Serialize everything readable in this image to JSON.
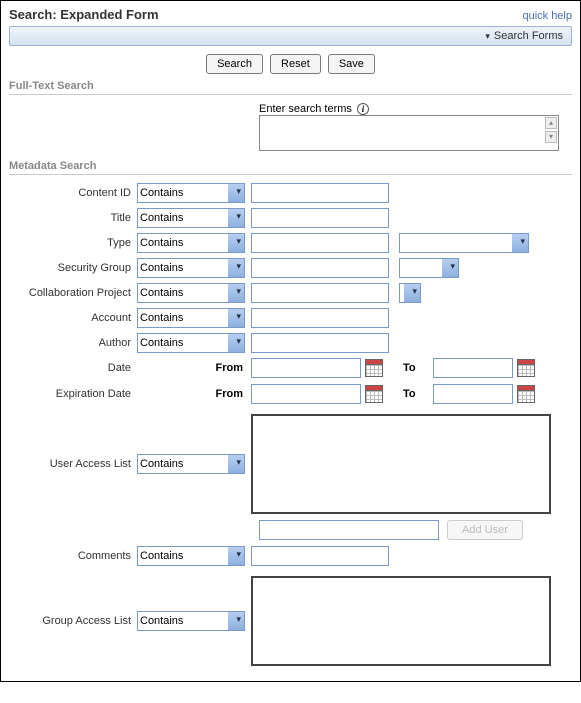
{
  "header": {
    "title": "Search: Expanded Form",
    "quick_help": "quick help",
    "search_forms_label": "Search Forms"
  },
  "buttons": {
    "search": "Search",
    "reset": "Reset",
    "save": "Save"
  },
  "sections": {
    "fulltext_title": "Full-Text Search",
    "fulltext_label": "Enter search terms",
    "metadata_title": "Metadata Search"
  },
  "operators": {
    "contains": "Contains"
  },
  "fields": {
    "content_id": "Content ID",
    "title": "Title",
    "type": "Type",
    "security_group": "Security Group",
    "collab_project": "Collaboration Project",
    "account": "Account",
    "author": "Author",
    "date": "Date",
    "expiration_date": "Expiration Date",
    "user_access_list": "User Access List",
    "comments": "Comments",
    "group_access_list": "Group Access List"
  },
  "date_labels": {
    "from": "From",
    "to": "To"
  },
  "add_user": {
    "button": "Add User"
  }
}
